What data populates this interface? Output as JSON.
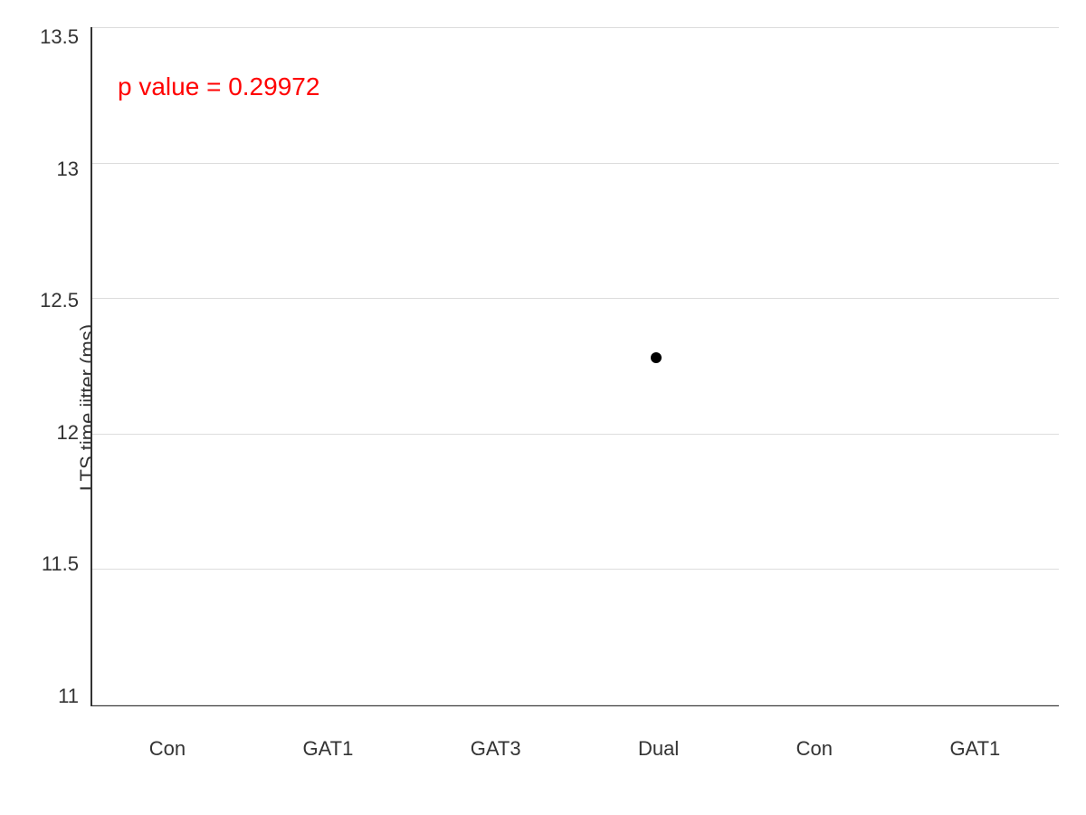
{
  "chart": {
    "title": "",
    "y_axis": {
      "title": "LTS time jitter (ms)",
      "min": 11,
      "max": 13.5,
      "labels": [
        "13.5",
        "13",
        "12.5",
        "12",
        "11.5",
        "11"
      ]
    },
    "x_axis": {
      "labels": [
        "Con",
        "GAT1",
        "GAT3",
        "Dual",
        "Con",
        "GAT1"
      ]
    },
    "p_value_label": "p value = 0.29972",
    "data_points": [
      {
        "x_label": "Dual",
        "x_index": 3,
        "y_value": 12.28
      }
    ]
  }
}
